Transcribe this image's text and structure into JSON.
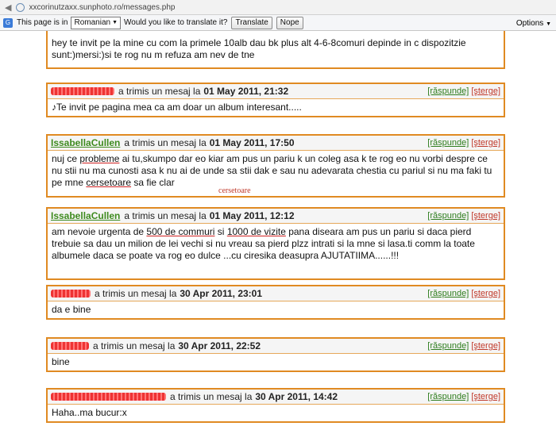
{
  "browser": {
    "url": "xxcorinutzaxx.sunphoto.ro/messages.php"
  },
  "translate_bar": {
    "prefix": "This page is in",
    "language": "Romanian",
    "question": "Would you like to translate it?",
    "translate_label": "Translate",
    "nope_label": "Nope",
    "options_label": "Options"
  },
  "messages": [
    {
      "user": "",
      "action_text": "a trimis un mesaj la",
      "date": "01 May 2011, 21:32",
      "reply": "[răspunde]",
      "delete": "[şterge]",
      "body": "♪Te invit pe pagina mea ca am doar un album interesant....."
    },
    {
      "user": "IssabellaCullen",
      "action_text": "a trimis un mesaj la",
      "date": "01 May 2011, 17:50",
      "reply": "[răspunde]",
      "delete": "[şterge]",
      "body_parts": [
        "nuj ce ",
        "probleme",
        " ai tu,skumpo dar eo kiar am pus un pariu k un coleg asa k te rog eo nu vorbi despre ce nu stii nu ma cunosti asa k nu ai de unde sa stii dak e sau nu adevarata chestia cu pariul si nu ma faki tu pe mne ",
        "cersetoare",
        " sa fie clar"
      ],
      "annotation": "cersetoare"
    },
    {
      "user": "IssabellaCullen",
      "action_text": "a trimis un mesaj la",
      "date": "01 May 2011, 12:12",
      "reply": "[răspunde]",
      "delete": "[şterge]",
      "body_parts": [
        "am nevoie urgenta de ",
        "500 de commuri",
        " si ",
        "1000 de vizite",
        " pana diseara am pus un pariu si daca pierd trebuie sa dau un milion de lei vechi si nu vreau sa pierd plzz intrati si la mne si lasa.ti comm la toate albumele daca se poate va rog eo dulce ...cu ciresika deasupra AJUTATIIMA......!!!"
      ]
    },
    {
      "user": "",
      "action_text": "a trimis un mesaj la",
      "date": "30 Apr 2011, 23:01",
      "reply": "[răspunde]",
      "delete": "[şterge]",
      "body": "da e bine"
    },
    {
      "user": "",
      "action_text": "a trimis un mesaj la",
      "date": "30 Apr 2011, 22:52",
      "reply": "[răspunde]",
      "delete": "[şterge]",
      "body": "bine"
    },
    {
      "user": "",
      "action_text": "a trimis un mesaj la",
      "date": "30 Apr 2011, 14:42",
      "reply": "[răspunde]",
      "delete": "[şterge]",
      "body": "Haha..ma bucur:x"
    }
  ],
  "top_partial_body": "hey te invit pe la mine cu com la primele 10alb dau bk plus alt 4-6-8comuri depinde in c dispozitzie sunt:)mersi:)si te rog nu m refuza am nev de tne"
}
